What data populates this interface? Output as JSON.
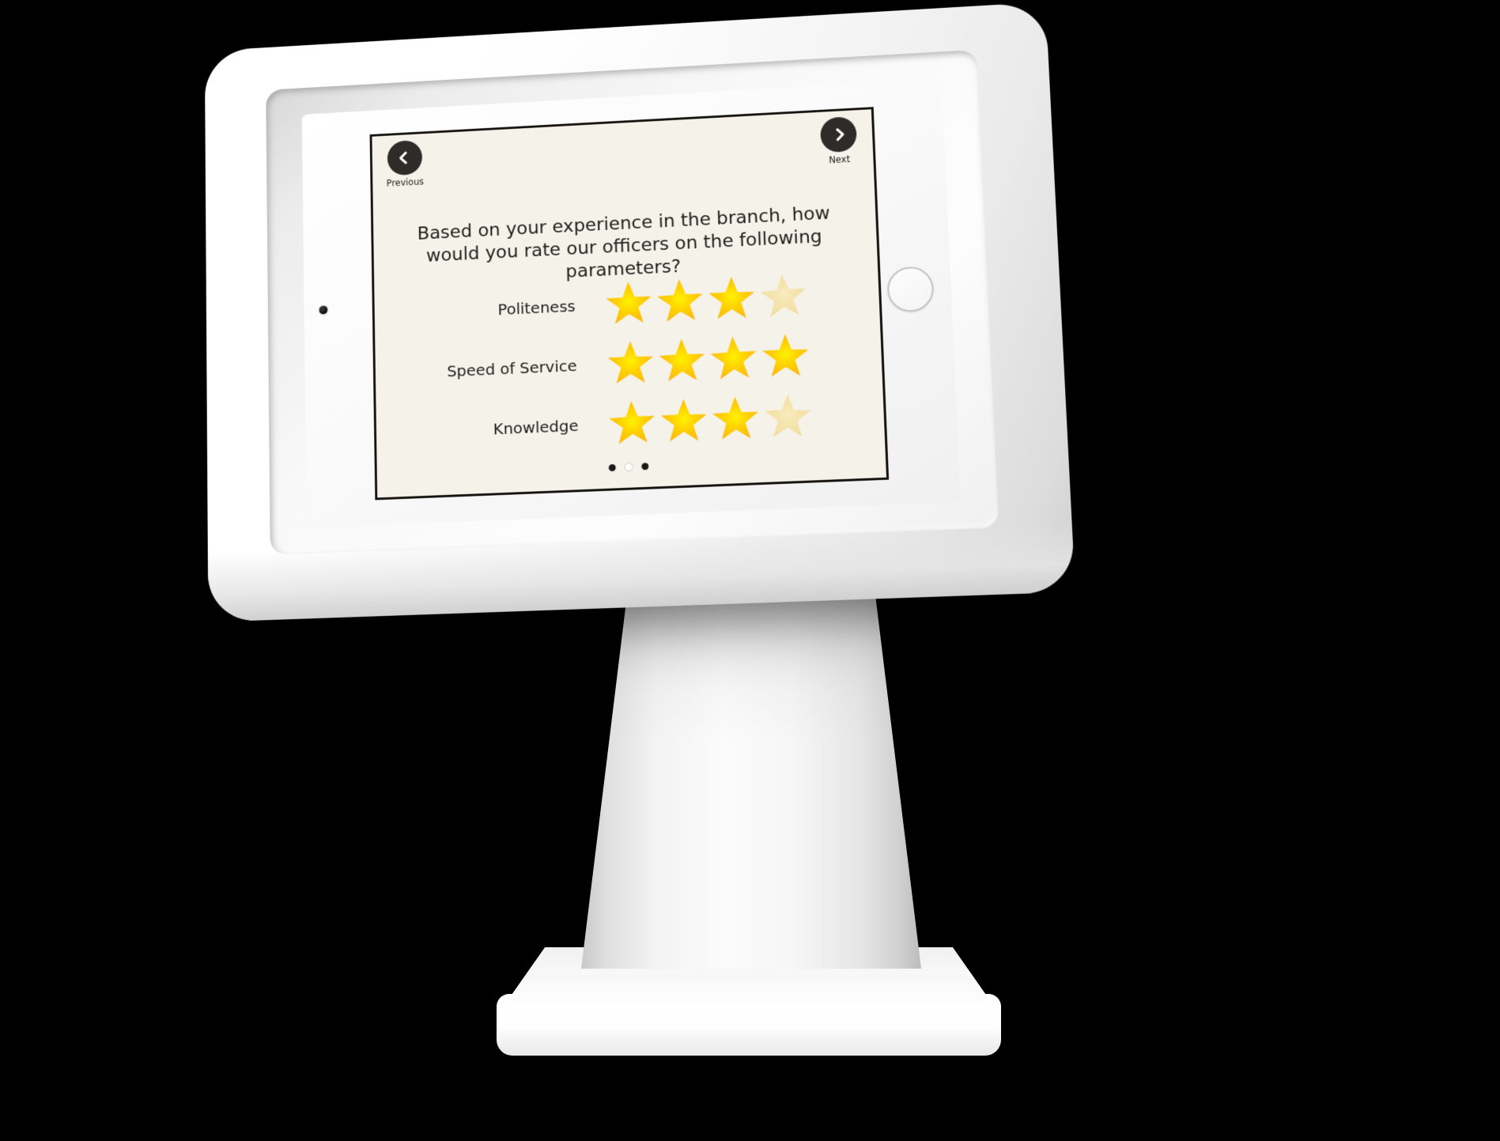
{
  "device": {
    "type": "tablet-kiosk",
    "shell_color": "#ffffff",
    "screen_bg": "#f5f2ea",
    "screen_border": "#15120f",
    "camera_icon": "camera-dot-icon",
    "home_button_icon": "home-button-icon"
  },
  "nav": {
    "previous": {
      "label": "Previous",
      "icon": "chevron-left-icon",
      "circle_color": "#2e2c29"
    },
    "next": {
      "label": "Next",
      "icon": "chevron-right-icon",
      "circle_color": "#2e2c29"
    }
  },
  "survey": {
    "question": "Based on your experience in the branch, how would you rate our officers on the following parameters?",
    "max_stars": 4,
    "star_filled_color": "#ffd000",
    "star_edge_color": "#fdb913",
    "star_empty_color": "#f6e3a8",
    "rows": [
      {
        "label": "Politeness",
        "rating": 3,
        "max": 4
      },
      {
        "label": "Speed of Service",
        "rating": 4,
        "max": 4
      },
      {
        "label": "Knowledge",
        "rating": 3,
        "max": 4
      }
    ]
  },
  "pagination": {
    "total": 3,
    "active_index": 1,
    "dots": [
      {
        "state": "inactive"
      },
      {
        "state": "active"
      },
      {
        "state": "inactive"
      }
    ]
  }
}
